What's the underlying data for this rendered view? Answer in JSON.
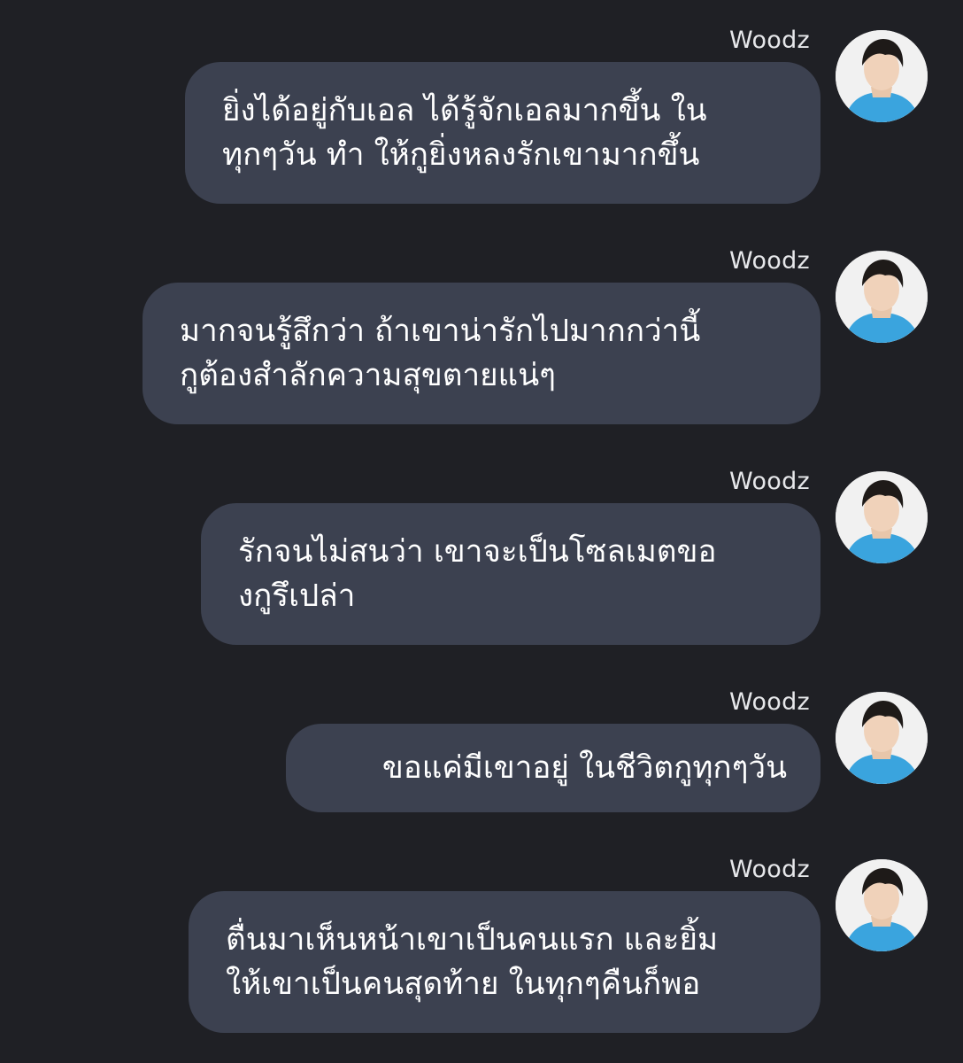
{
  "conversation": {
    "messages": [
      {
        "sender": "Woodz",
        "lines": [
          "ยิ่งได้อยู่กับเอล ได้รู้จักเอลมากขึ้น ใน",
          "ทุกๆวัน ทำ ให้กูยิ่งหลงรักเขามากขึ้น"
        ]
      },
      {
        "sender": "Woodz",
        "lines": [
          "มากจนรู้สึกว่า ถ้าเขาน่ารักไปมากกว่านี้",
          "กูต้องสำลักความสุขตายแน่ๆ"
        ]
      },
      {
        "sender": "Woodz",
        "lines": [
          "รักจนไม่สนว่า เขาจะเป็นโซลเมตขอ",
          "งกูรึเปล่า"
        ]
      },
      {
        "sender": "Woodz",
        "lines": [
          "ขอแค่มีเขาอยู่ ในชีวิตกูทุกๆวัน"
        ]
      },
      {
        "sender": "Woodz",
        "lines": [
          "ตื่นมาเห็นหน้าเขาเป็นคนแรก และยิ้ม",
          "ให้เขาเป็นคนสุดท้าย ในทุกๆคืนก็พอ"
        ]
      }
    ]
  },
  "colors": {
    "background": "#1f2025",
    "bubble": "#3c4150",
    "text": "#ffffff",
    "sender_name": "#e6e7ea"
  }
}
